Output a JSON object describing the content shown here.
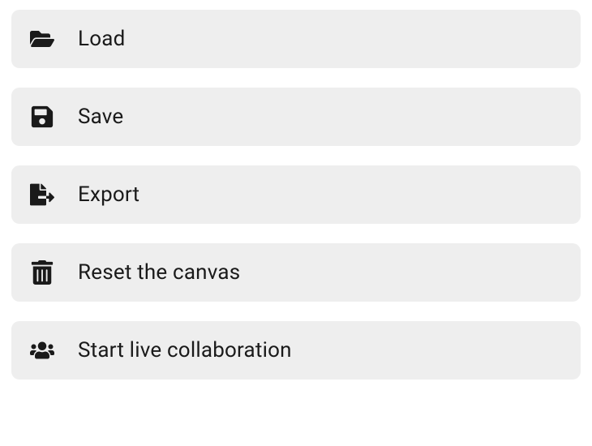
{
  "menu": {
    "items": [
      {
        "id": "load",
        "label": "Load",
        "icon": "folder-open-icon"
      },
      {
        "id": "save",
        "label": "Save",
        "icon": "save-disk-icon"
      },
      {
        "id": "export",
        "label": "Export",
        "icon": "file-export-icon"
      },
      {
        "id": "reset",
        "label": "Reset the canvas",
        "icon": "trash-icon"
      },
      {
        "id": "collaborate",
        "label": "Start live collaboration",
        "icon": "users-icon"
      }
    ]
  }
}
